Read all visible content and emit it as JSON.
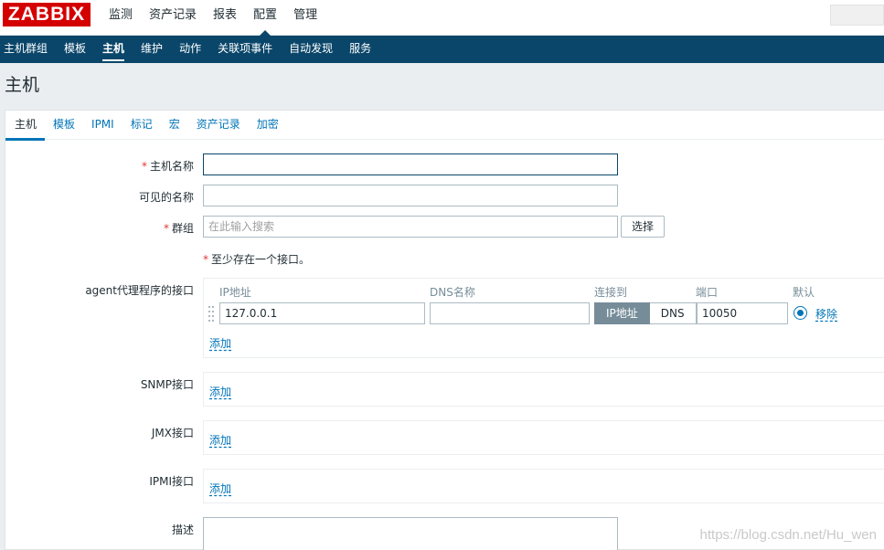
{
  "logo": {
    "text": "ZABBIX"
  },
  "top_menu": {
    "items": [
      "监测",
      "资产记录",
      "报表",
      "配置",
      "管理"
    ],
    "selected": "配置"
  },
  "sub_menu": {
    "items": [
      "主机群组",
      "模板",
      "主机",
      "维护",
      "动作",
      "关联项事件",
      "自动发现",
      "服务"
    ],
    "selected": "主机"
  },
  "page": {
    "title": "主机"
  },
  "tabs": {
    "items": [
      "主机",
      "模板",
      "IPMI",
      "标记",
      "宏",
      "资产记录",
      "加密"
    ],
    "active": "主机"
  },
  "form": {
    "host_name": {
      "label": "主机名称",
      "required_mark": "*",
      "value": ""
    },
    "visible_name": {
      "label": "可见的名称",
      "value": ""
    },
    "groups": {
      "label": "群组",
      "required_mark": "*",
      "placeholder": "在此输入搜索",
      "select_button": "选择"
    },
    "interface_note": {
      "mark": "*",
      "text": "至少存在一个接口。"
    },
    "agent_interfaces": {
      "label": "agent代理程序的接口",
      "headers": {
        "ip": "IP地址",
        "dns": "DNS名称",
        "connect": "连接到",
        "port": "端口",
        "default": "默认"
      },
      "row": {
        "ip": "127.0.0.1",
        "dns": "",
        "connect_options": [
          "IP地址",
          "DNS"
        ],
        "connect_selected": "IP地址",
        "port": "10050",
        "default_selected": true,
        "remove_label": "移除"
      },
      "add_label": "添加"
    },
    "snmp_interfaces": {
      "label": "SNMP接口",
      "add_label": "添加"
    },
    "jmx_interfaces": {
      "label": "JMX接口",
      "add_label": "添加"
    },
    "ipmi_interfaces": {
      "label": "IPMI接口",
      "add_label": "添加"
    },
    "description": {
      "label": "描述",
      "value": ""
    }
  },
  "watermark": "https://blog.csdn.net/Hu_wen",
  "colors": {
    "header_blue": "#0a466a",
    "link_blue": "#0275b8",
    "logo_red": "#d40000",
    "required_red": "#e33734"
  }
}
